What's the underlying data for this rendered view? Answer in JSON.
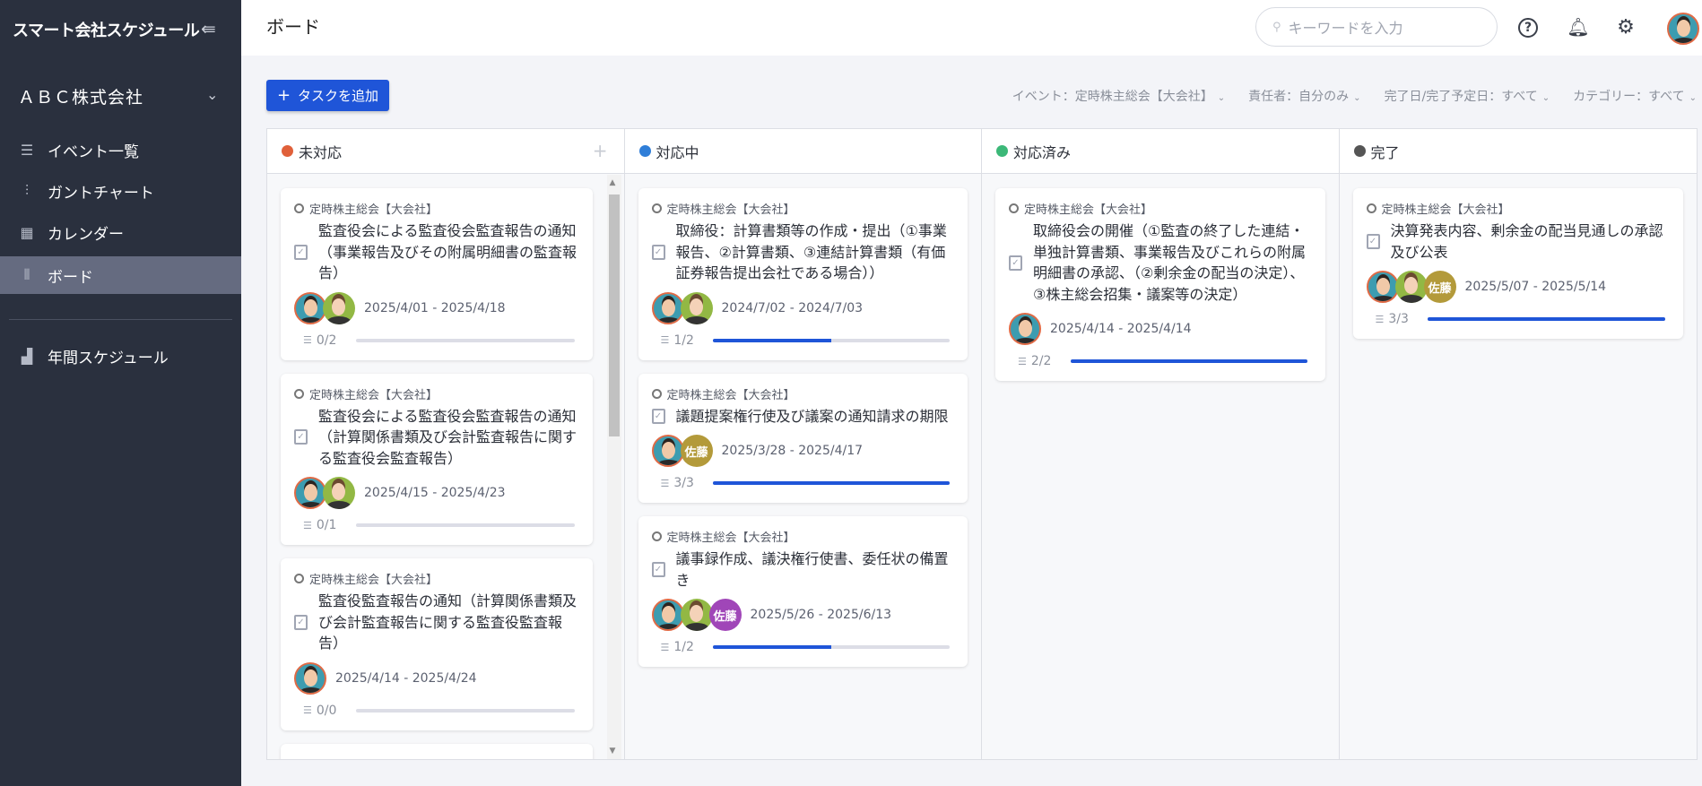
{
  "sidebar": {
    "app_title": "スマート会社スケジュール",
    "company": "ＡＢＣ株式会社",
    "items": [
      {
        "label": "イベント一覧",
        "icon": "list-icon"
      },
      {
        "label": "ガントチャート",
        "icon": "gantt-icon"
      },
      {
        "label": "カレンダー",
        "icon": "calendar-icon"
      },
      {
        "label": "ボード",
        "icon": "board-icon",
        "active": true
      }
    ],
    "annual": {
      "label": "年間スケジュール",
      "icon": "building-icon"
    }
  },
  "header": {
    "title": "ボード",
    "search_placeholder": "キーワードを入力"
  },
  "toolbar": {
    "add_task": "タスクを追加",
    "filters": [
      "イベント：定時株主総会【大会社】",
      "責任者：自分のみ",
      "完了日/完了予定日：すべて",
      "カテゴリー：すべて"
    ]
  },
  "colors": {
    "accent": "#1f55d8",
    "todo": "#e0603a",
    "doing": "#2f7ed8",
    "done": "#3cb878",
    "complete": "#555555"
  },
  "columns": [
    {
      "label": "未対応",
      "color": "#e0603a",
      "cards": [
        {
          "event": "定時株主総会【大会社】",
          "title": "監査役会による監査役会監査報告の通知（事業報告及びその附属明細書の監査報告）",
          "avatars": [
            "p1",
            "p2"
          ],
          "date": "2025/4/01 - 2025/4/18",
          "progress": "0/2",
          "done": 0,
          "total": 2
        },
        {
          "event": "定時株主総会【大会社】",
          "title": "監査役会による監査役会監査報告の通知（計算関係書類及び会計監査報告に関する監査役会監査報告）",
          "avatars": [
            "p1",
            "p2"
          ],
          "date": "2025/4/15 - 2025/4/23",
          "progress": "0/1",
          "done": 0,
          "total": 1
        },
        {
          "event": "定時株主総会【大会社】",
          "title": "監査役監査報告の通知（計算関係書類及び会計監査報告に関する監査役監査報告）",
          "avatars": [
            "p1"
          ],
          "date": "2025/4/14 - 2025/4/24",
          "progress": "0/0",
          "done": 0,
          "total": 0
        }
      ]
    },
    {
      "label": "対応中",
      "color": "#2f7ed8",
      "cards": [
        {
          "event": "定時株主総会【大会社】",
          "title": "取締役：計算書類等の作成・提出（①事業報告、②計算書類、③連結計算書類（有価証券報告提出会社である場合））",
          "avatars": [
            "p1",
            "p2"
          ],
          "date": "2024/7/02 - 2024/7/03",
          "progress": "1/2",
          "done": 1,
          "total": 2
        },
        {
          "event": "定時株主総会【大会社】",
          "title": "議題提案権行使及び議案の通知請求の期限",
          "avatars": [
            "p1",
            "sato-gold"
          ],
          "date": "2025/3/28 - 2025/4/17",
          "progress": "3/3",
          "done": 3,
          "total": 3
        },
        {
          "event": "定時株主総会【大会社】",
          "title": "議事録作成、議決権行使書、委任状の備置き",
          "avatars": [
            "p1",
            "p2",
            "sato-purple"
          ],
          "date": "2025/5/26 - 2025/6/13",
          "progress": "1/2",
          "done": 1,
          "total": 2
        }
      ]
    },
    {
      "label": "対応済み",
      "color": "#3cb878",
      "cards": [
        {
          "event": "定時株主総会【大会社】",
          "title": "取締役会の開催（①監査の終了した連結・単独計算書類、事業報告及びこれらの附属明細書の承認、（②剰余金の配当の決定）、③株主総会招集・議案等の決定）",
          "avatars": [
            "p1"
          ],
          "date": "2025/4/14 - 2025/4/14",
          "progress": "2/2",
          "done": 2,
          "total": 2
        }
      ]
    },
    {
      "label": "完了",
      "color": "#555555",
      "cards": [
        {
          "event": "定時株主総会【大会社】",
          "title": "決算発表内容、剰余金の配当見通しの承認及び公表",
          "avatars": [
            "p1",
            "p2",
            "sato-gold"
          ],
          "date": "2025/5/07 - 2025/5/14",
          "progress": "3/3",
          "done": 3,
          "total": 3
        }
      ]
    }
  ],
  "sato_label": "佐藤"
}
